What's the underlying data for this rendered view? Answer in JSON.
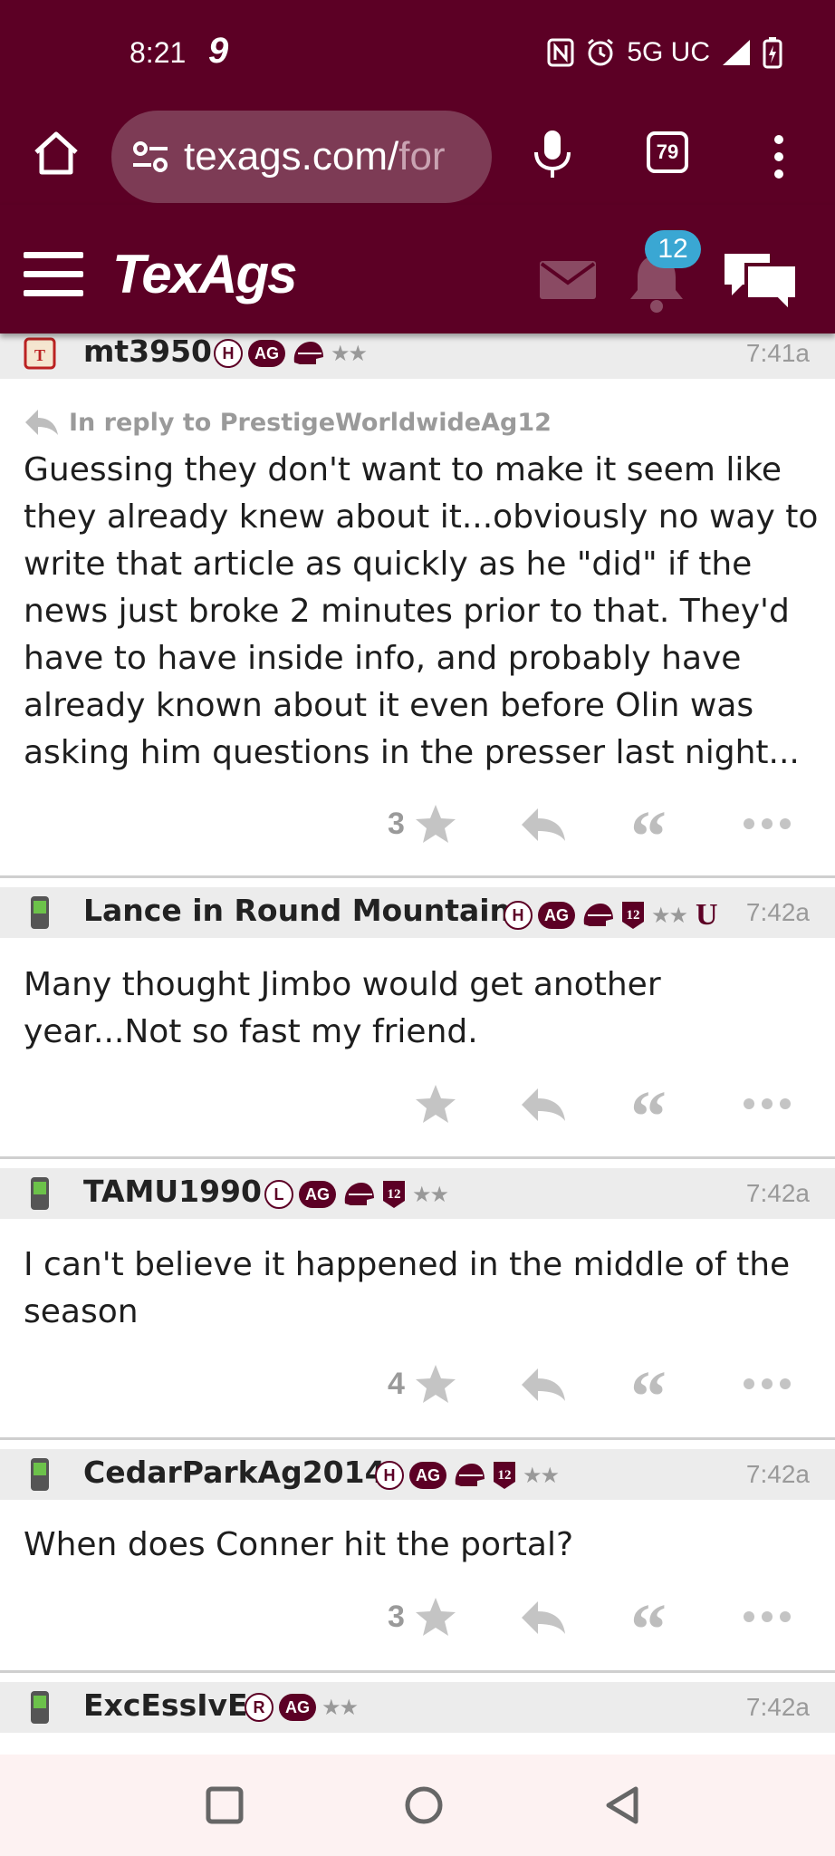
{
  "status_bar": {
    "time": "8:21",
    "carrier_glyph": "9",
    "network": "5G UC"
  },
  "browser": {
    "url_visible": "texags.com/",
    "url_faded": "for",
    "tab_count": "79"
  },
  "site": {
    "logo": "TexAgs",
    "notification_count": "12",
    "colors": {
      "brand": "#5c0025",
      "badge": "#3aa7d3"
    }
  },
  "posts": [
    {
      "username": "mt3950",
      "badge_letter": "H",
      "badge_ag": "AG",
      "stars": "★★",
      "time": "7:41a",
      "reply_to": "In reply to PrestigeWorldwideAg12",
      "body": "Guessing they don't want to make it seem like they already knew about it...obviously no way to write that article as quickly as he \"did\" if the news just broke 2 minutes prior to that. They'd have to have inside info, and probably have already known about it even before Olin was asking him questions in the presser last night...",
      "stars_count": "3"
    },
    {
      "username": "Lance in Round Mountain",
      "badge_letter": "H",
      "badge_ag": "AG",
      "badge_12": "12",
      "stars": "★★",
      "badge_u": "U",
      "time": "7:42a",
      "body": "Many thought Jimbo would get another year...Not so fast my friend.",
      "stars_count": ""
    },
    {
      "username": "TAMU1990",
      "badge_letter": "L",
      "badge_ag": "AG",
      "badge_12": "12",
      "stars": "★★",
      "time": "7:42a",
      "body": "I can't believe it happened in the middle of the season",
      "stars_count": "4"
    },
    {
      "username": "CedarParkAg2014",
      "badge_letter": "H",
      "badge_ag": "AG",
      "badge_12": "12",
      "stars": "★★",
      "time": "7:42a",
      "body": "When does Conner hit the portal?",
      "stars_count": "3"
    },
    {
      "username": "ExcEssIvE",
      "badge_letter": "R",
      "badge_ag": "AG",
      "stars": "★★",
      "time": "7:42a"
    }
  ],
  "actions": {
    "quote_glyph": "“"
  }
}
